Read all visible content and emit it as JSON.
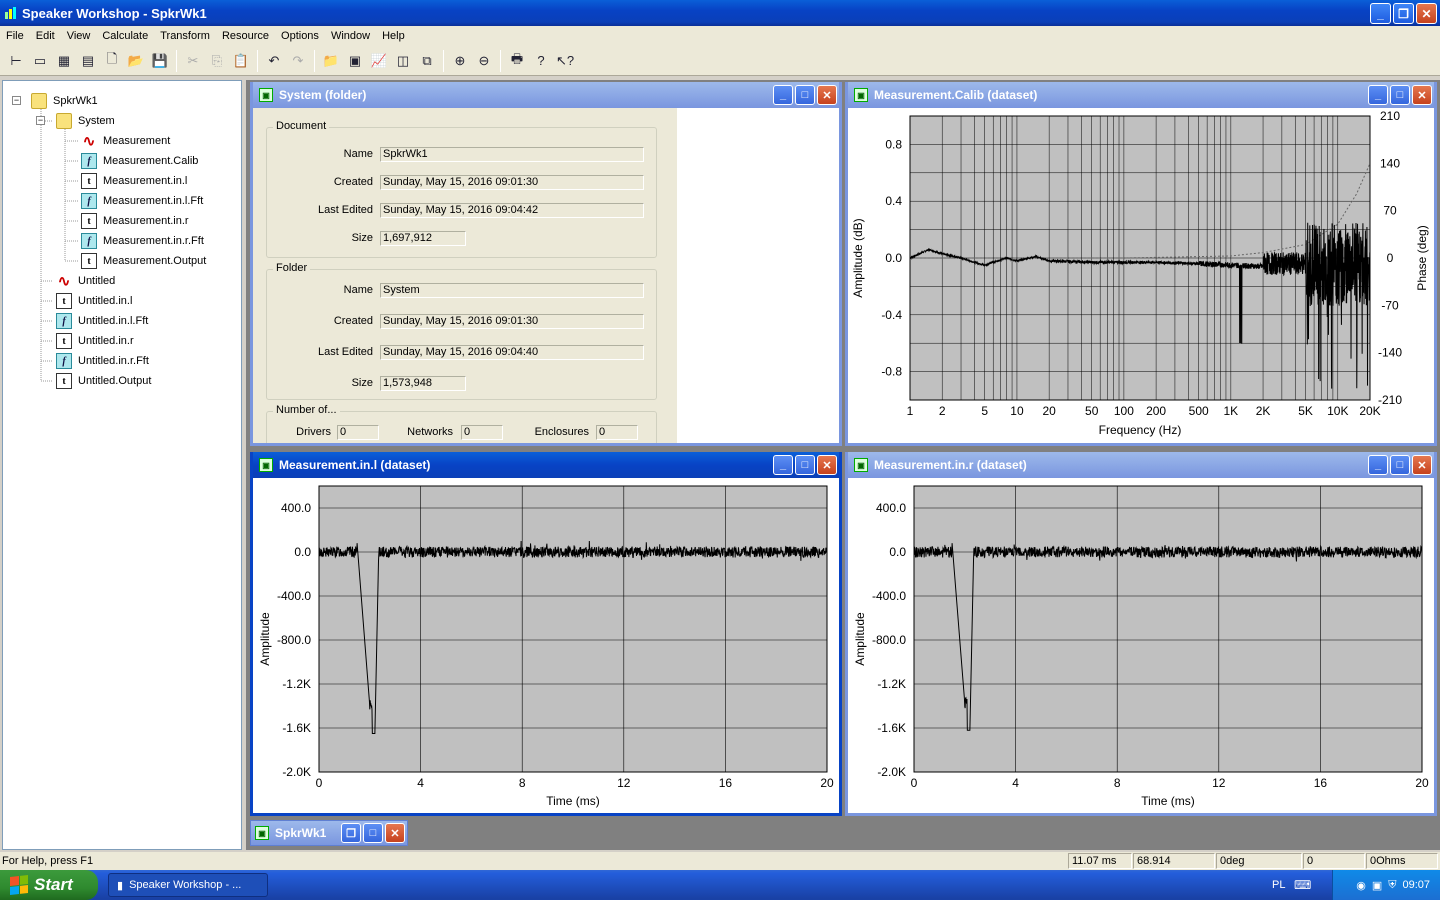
{
  "app": {
    "title": "Speaker Workshop - SpkrWk1"
  },
  "menu": [
    "File",
    "Edit",
    "View",
    "Calculate",
    "Transform",
    "Resource",
    "Options",
    "Window",
    "Help"
  ],
  "tree": [
    {
      "label": "SpkrWk1",
      "icon": "folder"
    },
    {
      "label": "System",
      "icon": "folder"
    },
    {
      "label": "Measurement",
      "icon": "wave"
    },
    {
      "label": "Measurement.Calib",
      "icon": "f"
    },
    {
      "label": "Measurement.in.l",
      "icon": "t"
    },
    {
      "label": "Measurement.in.l.Fft",
      "icon": "f"
    },
    {
      "label": "Measurement.in.r",
      "icon": "t"
    },
    {
      "label": "Measurement.in.r.Fft",
      "icon": "f"
    },
    {
      "label": "Measurement.Output",
      "icon": "t"
    },
    {
      "label": "Untitled",
      "icon": "wave"
    },
    {
      "label": "Untitled.in.l",
      "icon": "t"
    },
    {
      "label": "Untitled.in.l.Fft",
      "icon": "f"
    },
    {
      "label": "Untitled.in.r",
      "icon": "t"
    },
    {
      "label": "Untitled.in.r.Fft",
      "icon": "f"
    },
    {
      "label": "Untitled.Output",
      "icon": "t"
    }
  ],
  "folder_window": {
    "title": "System (folder)",
    "document": {
      "group": "Document",
      "name_label": "Name",
      "name": "SpkrWk1",
      "created_label": "Created",
      "created": "Sunday, May 15, 2016 09:01:30",
      "edited_label": "Last Edited",
      "edited": "Sunday, May 15, 2016 09:04:42",
      "size_label": "Size",
      "size": "1,697,912"
    },
    "folder": {
      "group": "Folder",
      "name_label": "Name",
      "name": "System",
      "created_label": "Created",
      "created": "Sunday, May 15, 2016 09:01:30",
      "edited_label": "Last Edited",
      "edited": "Sunday, May 15, 2016 09:04:40",
      "size_label": "Size",
      "size": "1,573,948"
    },
    "counts": {
      "group": "Number of...",
      "drivers_label": "Drivers",
      "drivers": "0",
      "networks_label": "Networks",
      "networks": "0",
      "enclosures_label": "Enclosures",
      "enclosures": "0"
    }
  },
  "calib_window": {
    "title": "Measurement.Calib (dataset)"
  },
  "left_window": {
    "title": "Measurement.in.l (dataset)"
  },
  "right_window": {
    "title": "Measurement.in.r (dataset)"
  },
  "minimized": {
    "title": "SpkrWk1"
  },
  "status": {
    "help": "For Help, press F1",
    "time": "11.07  ms",
    "value": "68.914",
    "phase": "0deg",
    "p4": "0",
    "ohms": "0Ohms"
  },
  "taskbar": {
    "start": "Start",
    "item": "Speaker Workshop - ...",
    "lang": "PL",
    "clock": "09:07"
  },
  "colors": {
    "plot_bg": "#c0c0c0",
    "titlebar": "#0843c5",
    "taskbar": "#245edb"
  },
  "chart_data": [
    {
      "type": "line",
      "title": "",
      "xlabel": "Frequency (Hz)",
      "ylabel": "Amplitude (dB)",
      "y2label": "Phase (deg)",
      "xscale": "log",
      "xlim": [
        1,
        20000
      ],
      "ylim": [
        -1.0,
        1.0
      ],
      "y2lim": [
        -210,
        210
      ],
      "x_ticks": [
        "1",
        "2",
        "5",
        "10",
        "20",
        "50",
        "100",
        "200",
        "500",
        "1K",
        "2K",
        "5K",
        "10K",
        "20K"
      ],
      "y_ticks": [
        "0.8",
        "0.4",
        "0.0",
        "-0.4",
        "-0.8"
      ],
      "y2_ticks": [
        "210",
        "140",
        "70",
        "0",
        "-70",
        "-140",
        "-210"
      ],
      "series": [
        {
          "values_desc": "amplitude",
          "x": [
            1,
            1.5,
            2,
            3,
            4,
            5,
            6,
            8,
            10,
            15,
            20,
            50,
            100,
            200,
            500,
            1000,
            2000,
            3000,
            5000,
            10000,
            15000,
            20000
          ],
          "y": [
            0.0,
            0.06,
            0.03,
            0.0,
            -0.03,
            -0.05,
            -0.03,
            0.0,
            -0.02,
            0.01,
            -0.02,
            -0.03,
            -0.03,
            -0.03,
            -0.04,
            -0.05,
            -0.06,
            -0.1,
            -0.4,
            -0.6,
            -0.95,
            -0.05
          ]
        },
        {
          "values_desc": "phase",
          "x": [
            1,
            10,
            100,
            1000,
            2000,
            5000,
            10000,
            15000,
            20000
          ],
          "y": [
            0,
            0,
            0,
            3,
            8,
            20,
            50,
            95,
            140
          ]
        }
      ],
      "grid": true,
      "legend": "none"
    },
    {
      "type": "line",
      "xlabel": "Time (ms)",
      "ylabel": "Amplitude",
      "xlim": [
        0,
        20
      ],
      "ylim": [
        -2000,
        600
      ],
      "x_ticks": [
        "0",
        "4",
        "8",
        "12",
        "16",
        "20"
      ],
      "y_ticks": [
        "400.0",
        "0.0",
        "-400.0",
        "-800.0",
        "-1.2K",
        "-1.6K",
        "-2.0K"
      ],
      "impulse_ms": 1.5,
      "impulse_min": -1650,
      "noise": 50,
      "grid": true,
      "legend": "none"
    },
    {
      "type": "line",
      "xlabel": "Time (ms)",
      "ylabel": "Amplitude",
      "xlim": [
        0,
        20
      ],
      "ylim": [
        -2000,
        600
      ],
      "x_ticks": [
        "0",
        "4",
        "8",
        "12",
        "16",
        "20"
      ],
      "y_ticks": [
        "400.0",
        "0.0",
        "-400.0",
        "-800.0",
        "-1.2K",
        "-1.6K",
        "-2.0K"
      ],
      "impulse_ms": 1.5,
      "impulse_min": -1620,
      "noise": 50,
      "grid": true,
      "legend": "none"
    }
  ]
}
